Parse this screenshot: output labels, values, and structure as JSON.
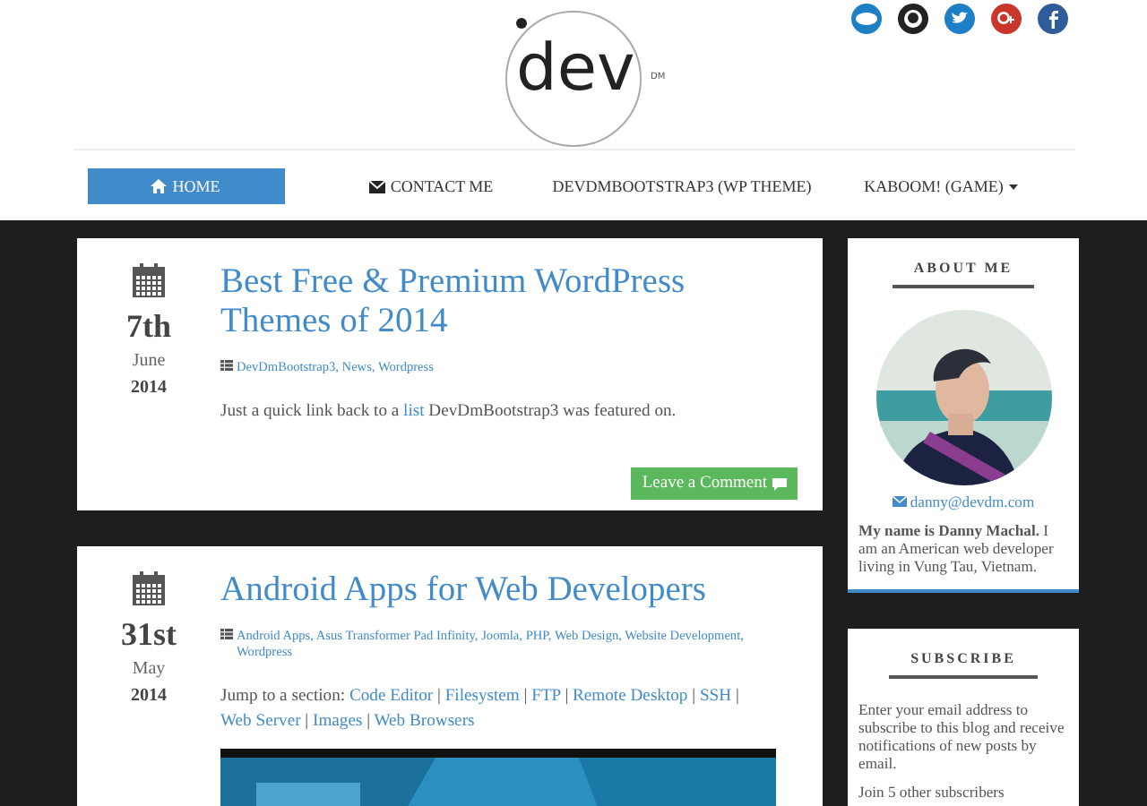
{
  "logo": {
    "text": "dev",
    "mark": "DM"
  },
  "nav": [
    {
      "label": "HOME",
      "selected": true
    },
    {
      "label": "CONTACT ME",
      "selected": false
    },
    {
      "label": "DEVDMBOOTSTRAP3 (WP THEME)",
      "selected": false
    },
    {
      "label": "KABOOM! (GAME)",
      "selected": false
    }
  ],
  "posts": [
    {
      "day": "7th",
      "month": "June",
      "year": "2014",
      "title": "Best Free & Premium WordPress Themes of 2014",
      "categories": [
        {
          "text": "DevDmBootstrap3",
          "link": true
        },
        {
          "text": ", "
        },
        {
          "text": "News",
          "link": true
        },
        {
          "text": ", "
        },
        {
          "text": "Wordpress",
          "link": true
        }
      ],
      "body": [
        {
          "text": "Just a quick link back to a "
        },
        {
          "text": "list",
          "link": true
        },
        {
          "text": " DevDmBootstrap3 was featured on."
        }
      ],
      "button": "Leave a Comment"
    },
    {
      "day": "31st",
      "month": "May",
      "year": "2014",
      "title": "Android Apps for Web Developers",
      "categories": [
        {
          "text": "Android Apps",
          "link": true
        },
        {
          "text": ", "
        },
        {
          "text": "Asus Transformer Pad Infinity",
          "link": true
        },
        {
          "text": ", "
        },
        {
          "text": "Joomla",
          "link": true
        },
        {
          "text": ", "
        },
        {
          "text": "PHP",
          "link": true
        },
        {
          "text": ", "
        },
        {
          "text": "Web Design",
          "link": true
        },
        {
          "text": ", "
        },
        {
          "text": "Website Development",
          "link": true
        },
        {
          "text": ", "
        },
        {
          "text": "Wordpress",
          "link": true
        }
      ],
      "body": [
        {
          "text": "Jump to a section: "
        },
        {
          "text": "Code Editor",
          "link": true
        },
        {
          "text": " | "
        },
        {
          "text": "Filesystem",
          "link": true
        },
        {
          "text": " | "
        },
        {
          "text": "FTP",
          "link": true
        },
        {
          "text": " | "
        },
        {
          "text": "Remote Desktop",
          "link": true
        },
        {
          "text": " | "
        },
        {
          "text": "SSH",
          "link": true
        },
        {
          "text": " | "
        },
        {
          "text": "Web Server",
          "link": true
        },
        {
          "text": " | "
        },
        {
          "text": "Images",
          "link": true
        },
        {
          "text": " | "
        },
        {
          "text": "Web Browsers",
          "link": true
        }
      ]
    }
  ],
  "sidebar": {
    "about": {
      "title": "ABOUT ME",
      "email": "danny@devdm.com",
      "bio": "**My name is Danny Machal.** I am an American web developer living in Vung Tau, Vietnam."
    },
    "subscribe": {
      "title": "SUBSCRIBE",
      "text": "Enter your email address to subscribe to this blog and receive notifications of new posts by email.",
      "note": "Join 5 other subscribers"
    }
  }
}
